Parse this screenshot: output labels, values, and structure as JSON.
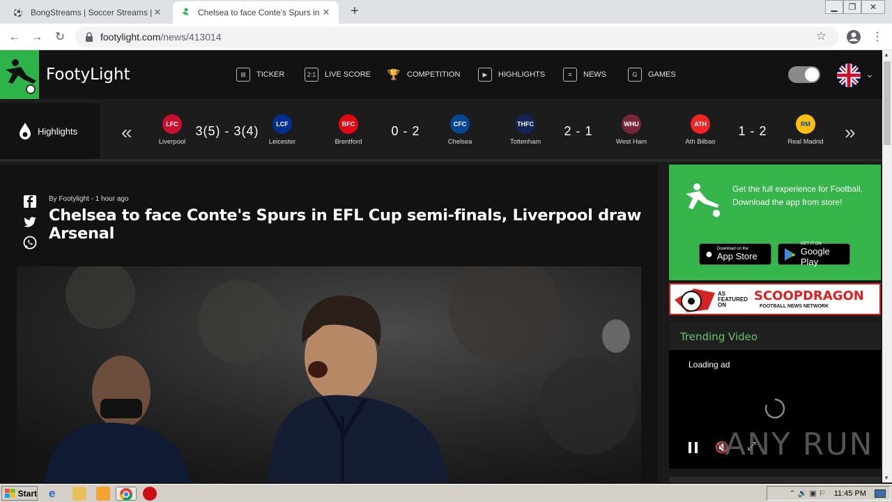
{
  "browser": {
    "tabs": [
      {
        "title": "BongStreams | Soccer Streams | NBA",
        "active": false
      },
      {
        "title": "Chelsea to face Conte's Spurs in EFL",
        "active": true
      }
    ],
    "new_tab": "+",
    "url_host": "footylight.com",
    "url_path": "/news/413014"
  },
  "site": {
    "brand": "FootyLight",
    "nav": [
      {
        "label": "TICKER",
        "icon": "ticker-icon"
      },
      {
        "label": "LIVE SCORE",
        "icon": "live-score-icon"
      },
      {
        "label": "COMPETITION",
        "icon": "trophy-icon"
      },
      {
        "label": "HIGHLIGHTS",
        "icon": "play-icon"
      },
      {
        "label": "NEWS",
        "icon": "news-icon"
      },
      {
        "label": "GAMES",
        "icon": "games-icon"
      }
    ],
    "brand_color": "#2db34a"
  },
  "scores": {
    "label": "Highlights",
    "matches": [
      {
        "home": "Liverpool",
        "score": "3(5) - 3(4)",
        "away": "Leicester"
      },
      {
        "home": "Brentford",
        "score": "0 - 2",
        "away": "Chelsea"
      },
      {
        "home": "Tottenham",
        "score": "2 - 1",
        "away": "West Ham"
      },
      {
        "home": "Ath Bilbao",
        "score": "1 - 2",
        "away": "Real Madrid"
      }
    ]
  },
  "article": {
    "byline": "By Footylight - 1 hour ago",
    "headline": "Chelsea to face Conte's Spurs in EFL Cup semi-finals, Liverpool draw Arsenal"
  },
  "sidebar": {
    "promo_text": "Get the full experience for Football, Download the app from store!",
    "app_store_sub": "Download on the",
    "app_store_main": "App Store",
    "google_play_sub": "GET IT ON",
    "google_play_main": "Google Play",
    "scoop_featured": "AS FEATURED ON",
    "scoop_title": "SCOOPDRAGON",
    "scoop_sub": "FOOTBALL NEWS NETWORK",
    "trending_title": "Trending Video",
    "loading_text": "Loading ad",
    "watermark": "ANY RUN"
  },
  "taskbar": {
    "start": "Start",
    "clock": "11:45 PM"
  }
}
